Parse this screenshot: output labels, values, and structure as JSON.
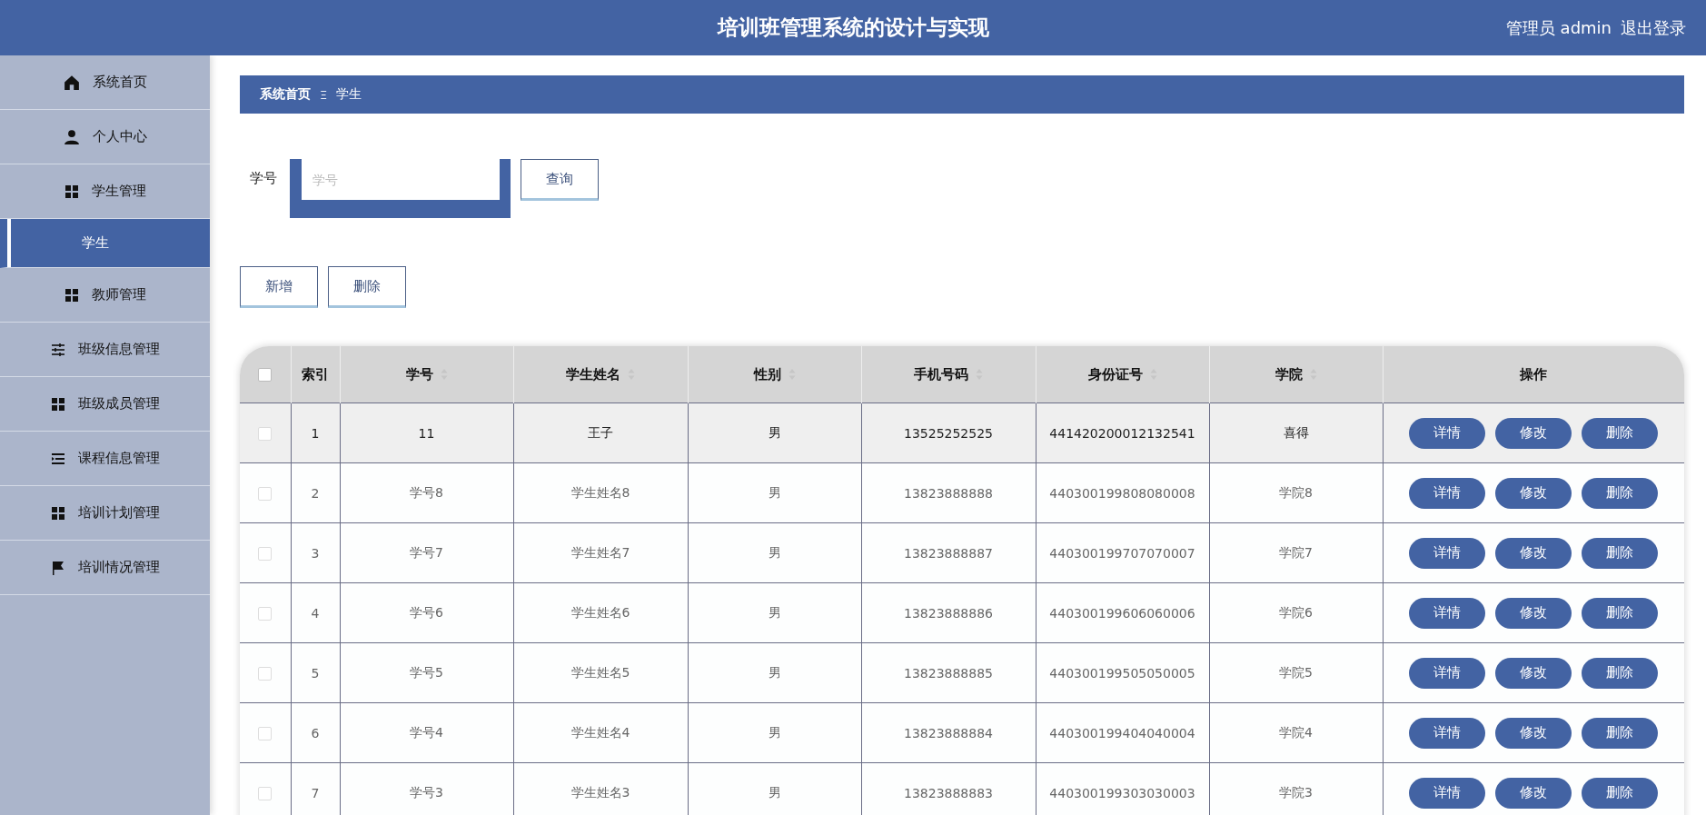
{
  "header": {
    "title": "培训班管理系统的设计与实现",
    "user": "管理员 admin",
    "logout": "退出登录"
  },
  "sidebar": {
    "items": [
      {
        "label": "系统首页",
        "kind": "home",
        "selected": false
      },
      {
        "label": "个人中心",
        "kind": "person",
        "selected": false
      },
      {
        "label": "学生管理",
        "kind": "grid",
        "selected": false,
        "children": [
          {
            "label": "学生",
            "selected": true
          }
        ]
      },
      {
        "label": "教师管理",
        "kind": "grid",
        "selected": false
      },
      {
        "label": "班级信息管理",
        "kind": "sliders",
        "selected": false
      },
      {
        "label": "班级成员管理",
        "kind": "grid",
        "selected": false
      },
      {
        "label": "课程信息管理",
        "kind": "list",
        "selected": false
      },
      {
        "label": "培训计划管理",
        "kind": "grid",
        "selected": false
      },
      {
        "label": "培训情况管理",
        "kind": "flag",
        "selected": false
      }
    ]
  },
  "breadcrumb": {
    "items": [
      "系统首页",
      "学生"
    ],
    "separator": "Ξ"
  },
  "search": {
    "label": "学号",
    "placeholder": "学号",
    "button": "查询"
  },
  "actions": [
    "新增",
    "删除"
  ],
  "table": {
    "select_all_checked": false,
    "columns": [
      {
        "label": "索引",
        "sortable": false
      },
      {
        "label": "学号",
        "sortable": true
      },
      {
        "label": "学生姓名",
        "sortable": true
      },
      {
        "label": "性别",
        "sortable": true
      },
      {
        "label": "手机号码",
        "sortable": true
      },
      {
        "label": "身份证号",
        "sortable": true
      },
      {
        "label": "学院",
        "sortable": true
      },
      {
        "label": "操作",
        "sortable": false
      }
    ],
    "rows": [
      {
        "checked": false,
        "highlighted": true,
        "cells": [
          "1",
          "11",
          "王子",
          "男",
          "13525252525",
          "441420200012132541",
          "喜得"
        ],
        "buttons": [
          "详情",
          "修改",
          "删除"
        ]
      },
      {
        "checked": false,
        "highlighted": false,
        "cells": [
          "2",
          "学号8",
          "学生姓名8",
          "男",
          "13823888888",
          "440300199808080008",
          "学院8"
        ],
        "buttons": [
          "详情",
          "修改",
          "删除"
        ]
      },
      {
        "checked": false,
        "highlighted": false,
        "cells": [
          "3",
          "学号7",
          "学生姓名7",
          "男",
          "13823888887",
          "440300199707070007",
          "学院7"
        ],
        "buttons": [
          "详情",
          "修改",
          "删除"
        ]
      },
      {
        "checked": false,
        "highlighted": false,
        "cells": [
          "4",
          "学号6",
          "学生姓名6",
          "男",
          "13823888886",
          "440300199606060006",
          "学院6"
        ],
        "buttons": [
          "详情",
          "修改",
          "删除"
        ]
      },
      {
        "checked": false,
        "highlighted": false,
        "cells": [
          "5",
          "学号5",
          "学生姓名5",
          "男",
          "13823888885",
          "440300199505050005",
          "学院5"
        ],
        "buttons": [
          "详情",
          "修改",
          "删除"
        ]
      },
      {
        "checked": false,
        "highlighted": false,
        "cells": [
          "6",
          "学号4",
          "学生姓名4",
          "男",
          "13823888884",
          "440300199404040004",
          "学院4"
        ],
        "buttons": [
          "详情",
          "修改",
          "删除"
        ]
      },
      {
        "checked": false,
        "highlighted": false,
        "cells": [
          "7",
          "学号3",
          "学生姓名3",
          "男",
          "13823888883",
          "440300199303030003",
          "学院3"
        ],
        "buttons": [
          "详情",
          "修改",
          "删除"
        ]
      }
    ]
  }
}
